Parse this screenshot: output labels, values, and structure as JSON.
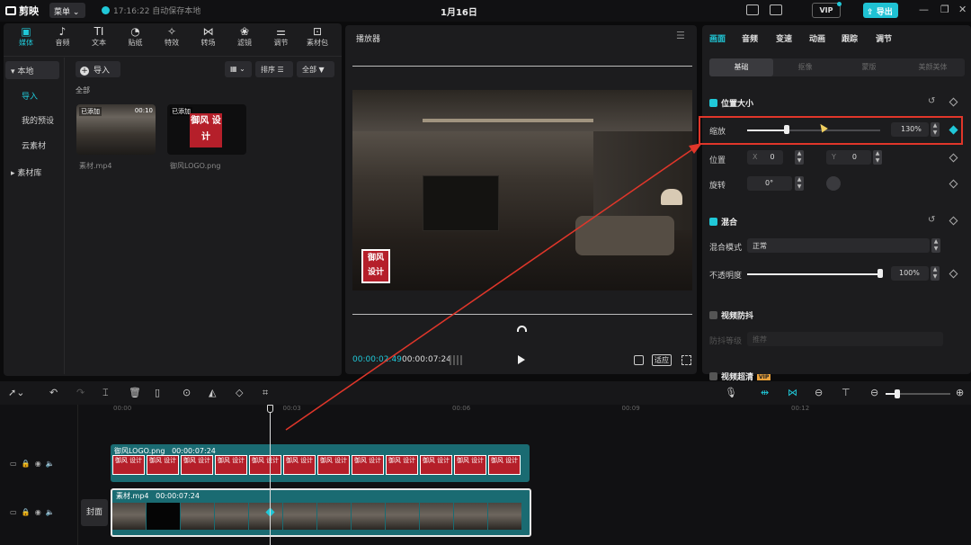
{
  "app": {
    "logo_text": "剪映",
    "menu_label": "菜单",
    "save_status": "17:16:22 自动保存本地",
    "date": "1月16日",
    "vip_label": "VIP",
    "export_label": "导出"
  },
  "toolbar": [
    {
      "label": "媒体",
      "icon": "media-icon",
      "glyph": "▣"
    },
    {
      "label": "音频",
      "icon": "audio-icon",
      "glyph": "♪"
    },
    {
      "label": "文本",
      "icon": "text-icon",
      "glyph": "TI"
    },
    {
      "label": "贴纸",
      "icon": "sticker-icon",
      "glyph": "◔"
    },
    {
      "label": "特效",
      "icon": "effects-icon",
      "glyph": "✧"
    },
    {
      "label": "转场",
      "icon": "transition-icon",
      "glyph": "⋈"
    },
    {
      "label": "滤镜",
      "icon": "filter-icon",
      "glyph": "❀"
    },
    {
      "label": "调节",
      "icon": "adjust-icon",
      "glyph": "⚌"
    },
    {
      "label": "素材包",
      "icon": "package-icon",
      "glyph": "⊡"
    }
  ],
  "sidebar": {
    "local": "本地",
    "import": "导入",
    "presets": "我的预设",
    "cloud": "云素材",
    "library": "素材库"
  },
  "media": {
    "import_button": "导入",
    "sort_label": "排序",
    "filter_label": "全部",
    "section_all": "全部",
    "items": [
      {
        "name": "素材.mp4",
        "tag": "已添加",
        "duration": "00:10"
      },
      {
        "name": "御风LOGO.png",
        "tag": "已添加",
        "logo_text": "御风 设计"
      }
    ]
  },
  "player": {
    "title": "播放器",
    "current_time": "00:00:02:49",
    "total_time": "00:00:07:24",
    "fit_label": "适应",
    "overlay_logo": "御风 设计"
  },
  "inspector": {
    "tabs": [
      "画面",
      "音频",
      "变速",
      "动画",
      "跟踪",
      "调节"
    ],
    "subtabs": [
      "基础",
      "抠像",
      "蒙版",
      "美颜美体"
    ],
    "position_size": {
      "title": "位置大小",
      "scale_label": "缩放",
      "scale_value": "130%",
      "scale_fraction": 0.3,
      "position_label": "位置",
      "x_label": "X",
      "x_value": "0",
      "y_label": "Y",
      "y_value": "0",
      "rotate_label": "旋转",
      "rotate_value": "0°"
    },
    "blend": {
      "title": "混合",
      "mode_label": "混合模式",
      "mode_value": "正常",
      "opacity_label": "不透明度",
      "opacity_value": "100%",
      "opacity_fraction": 1.0
    },
    "stabilize": {
      "title": "视频防抖",
      "level_label": "防抖等级",
      "level_value": "推荐"
    },
    "super_res": {
      "title": "视频超清"
    }
  },
  "timeline": {
    "ruler": [
      "00:00",
      "00:03",
      "00:06",
      "00:09",
      "00:12"
    ],
    "overlay_clip": {
      "name": "御风LOGO.png",
      "duration": "00:00:07:24",
      "frame_text": "御风 设计"
    },
    "main_clip": {
      "name": "素材.mp4",
      "duration": "00:00:07:24"
    },
    "cover_label": "封面"
  },
  "colors": {
    "accent": "#20c8d8",
    "highlight": "#e0362a",
    "clip": "#1a6b72"
  }
}
